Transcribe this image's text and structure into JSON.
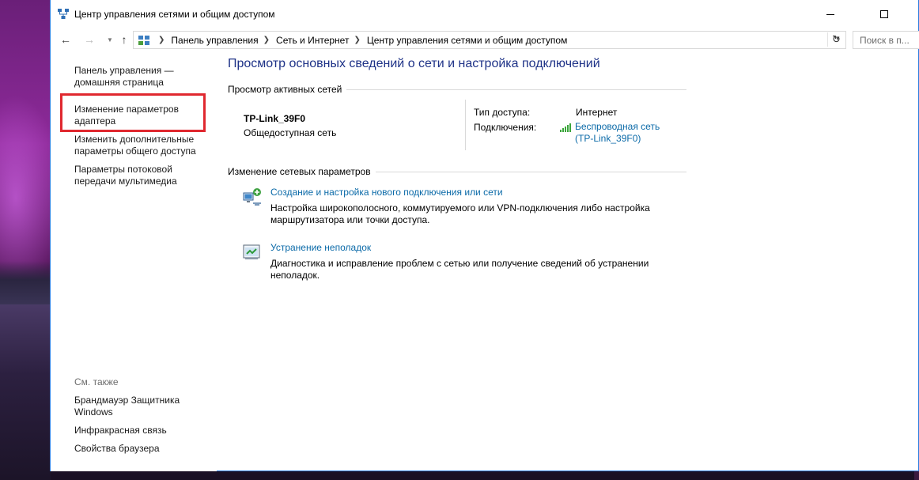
{
  "window": {
    "title": "Центр управления сетями и общим доступом"
  },
  "address_bar": {
    "breadcrumbs": [
      "Панель управления",
      "Сеть и Интернет",
      "Центр управления сетями и общим доступом"
    ],
    "search_placeholder": "Поиск в п..."
  },
  "left_pane": {
    "links": [
      "Панель управления — домашняя страница",
      "Изменение параметров адаптера",
      "Изменить дополнительные параметры общего доступа",
      "Параметры потоковой передачи мультимедиа"
    ],
    "see_also_title": "См. также",
    "see_also_links": [
      "Брандмауэр Защитника Windows",
      "Инфракрасная связь",
      "Свойства браузера"
    ]
  },
  "main": {
    "heading": "Просмотр основных сведений о сети и настройка подключений",
    "active_networks_label": "Просмотр активных сетей",
    "network": {
      "name": "TP-Link_39F0",
      "type": "Общедоступная сеть",
      "access_type_label": "Тип доступа:",
      "access_type_value": "Интернет",
      "connections_label": "Подключения:",
      "connection_link": "Беспроводная сеть (TP-Link_39F0)"
    },
    "change_settings_label": "Изменение сетевых параметров",
    "tasks": [
      {
        "title": "Создание и настройка нового подключения или сети",
        "description": "Настройка широкополосного, коммутируемого или VPN-подключения либо настройка маршрутизатора или точки доступа.",
        "icon": "new-connection-icon"
      },
      {
        "title": "Устранение неполадок",
        "description": "Диагностика и исправление проблем с сетью или получение сведений об устранении неполадок.",
        "icon": "troubleshoot-icon"
      }
    ]
  },
  "colors": {
    "link": "#0b6aa8",
    "heading": "#1e3287",
    "highlight": "#e0282f",
    "window_border": "#2b7de0"
  }
}
